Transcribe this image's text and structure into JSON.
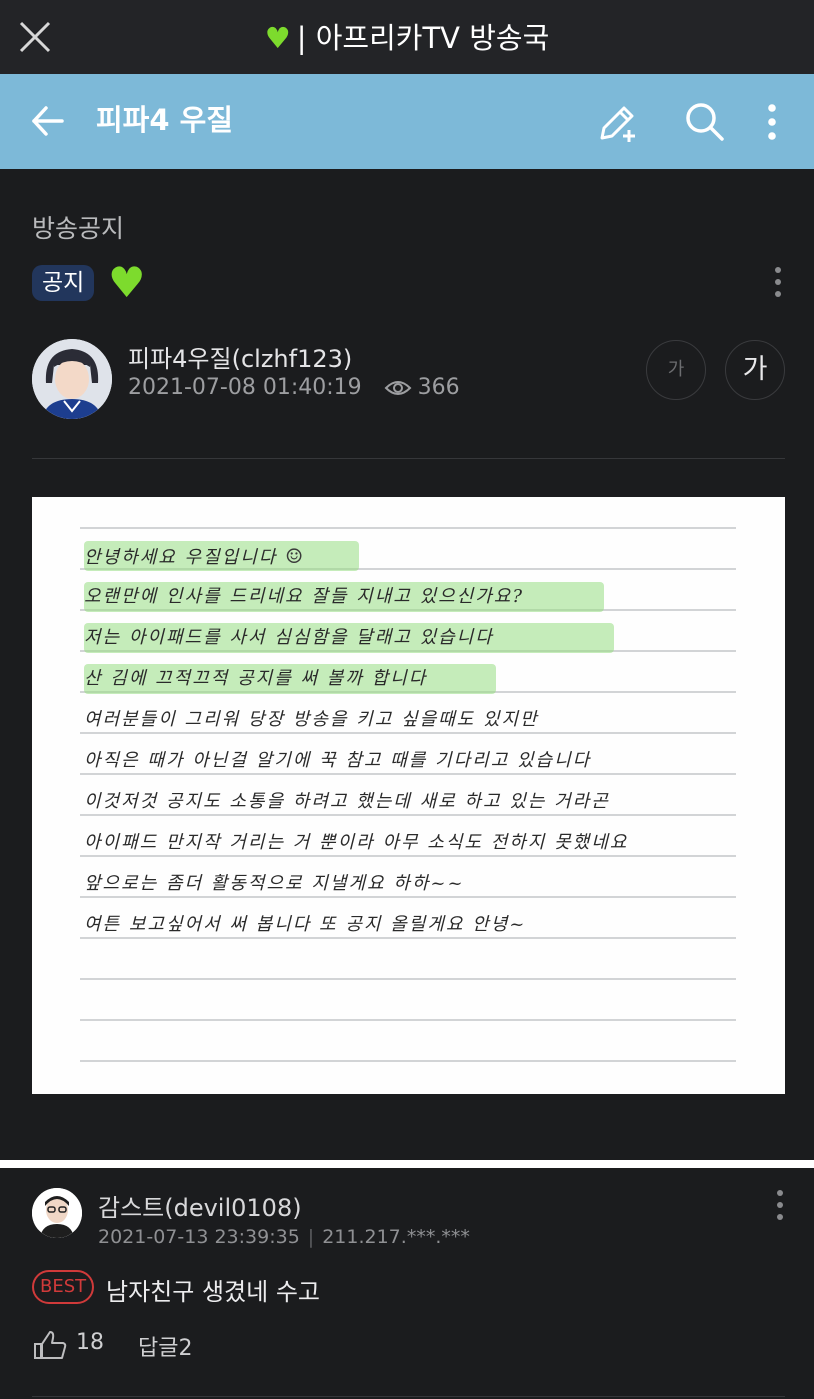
{
  "window": {
    "title": "| 아프리카TV 방송국",
    "heart_icon": "green-heart-icon"
  },
  "appbar": {
    "title": "피파4 우질",
    "bg": "#7db9d8"
  },
  "post": {
    "category": "방송공지",
    "badge": "공지",
    "author": "피파4우질(clzhf123)",
    "datetime": "2021-07-08 01:40:19",
    "views": "366",
    "font_small": "가",
    "font_large": "가",
    "note_lines": [
      "안녕하세요 우질입니다",
      "오랜만에 인사를 드리네요 잘들 지내고 있으신가요?",
      "저는 아이패드를 사서 심심함을 달래고 있습니다",
      "산 김에 끄적끄적 공지를 써 볼까 합니다",
      "여러분들이 그리워 당장 방송을 키고 싶을때도 있지만",
      "아직은 때가 아닌걸 알기에 꾹 참고 때를 기다리고 있습니다",
      "이것저것 공지도 소통을 하려고 했는데 새로 하고 있는 거라곤",
      "아이패드 만지작 거리는 거 뿐이라 아무 소식도 전하지 못했네요",
      "앞으로는 좀더 활동적으로 지낼게요 하하~~",
      "여튼 보고싶어서 써 봅니다 또 공지 올릴게요 안녕~"
    ]
  },
  "comment": {
    "author": "감스트(devil0108)",
    "datetime": "2021-07-13 23:39:35",
    "ip": "211.217.***.***",
    "best_label": "BEST",
    "text": "남자친구 생겼네 수고",
    "like_count": "18",
    "reply_label": "답글2"
  },
  "colors": {
    "accent": "#7db9d8",
    "best": "#d03a3a",
    "heart": "#7ddb2d"
  }
}
